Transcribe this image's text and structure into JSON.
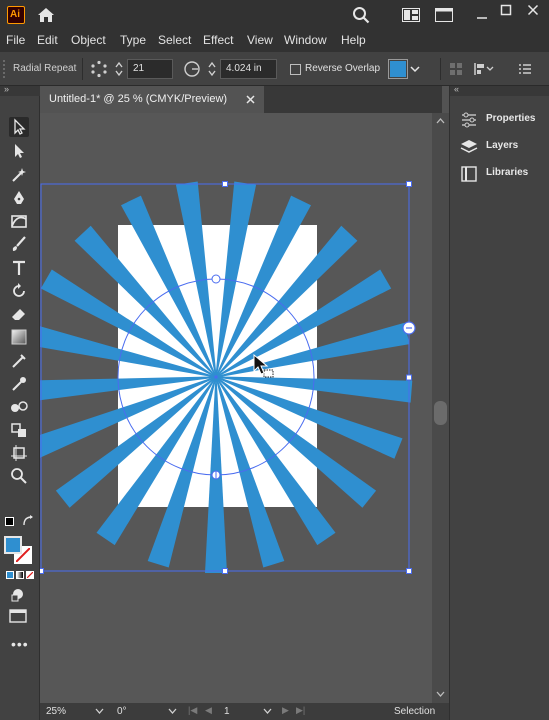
{
  "app": {
    "logo_text": "Ai"
  },
  "menubar": {
    "items": [
      "File",
      "Edit",
      "Object",
      "Type",
      "Select",
      "Effect",
      "View",
      "Window",
      "Help"
    ]
  },
  "controlbar": {
    "mode_label": "Radial Repeat",
    "instances_value": "21",
    "radius_value": "4.024 in",
    "reverse_overlap_label": "Reverse Overlap",
    "reverse_overlap_checked": false,
    "fill_color": "#2f8fd0"
  },
  "document": {
    "tab_title": "Untitled-1* @ 25 % (CMYK/Preview)"
  },
  "rightpanel": {
    "items": [
      "Properties",
      "Layers",
      "Libraries"
    ]
  },
  "toolbar": {
    "fill_color": "#2f8fd0"
  },
  "artwork": {
    "instances": 21,
    "ray_color": "#2f8fd0",
    "artboard_color": "#ffffff",
    "selection_color": "#4a6cf0"
  },
  "statusbar": {
    "zoom": "25%",
    "rotation": "0°",
    "artboard_number": "1",
    "tool_name": "Selection"
  }
}
